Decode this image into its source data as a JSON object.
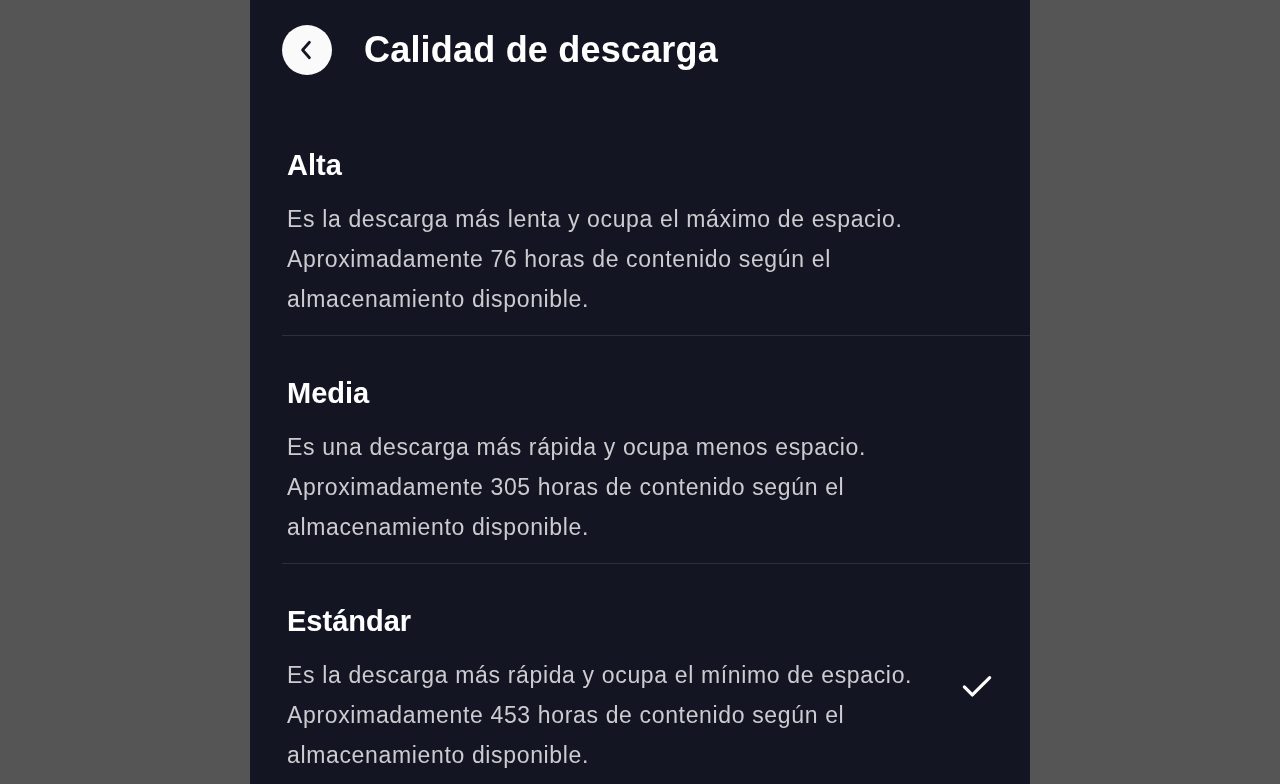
{
  "header": {
    "title": "Calidad de descarga"
  },
  "options": [
    {
      "title": "Alta",
      "description": "Es la descarga más lenta y ocupa el máximo de espacio. Aproximadamente 76 horas de contenido según el almacenamiento disponible.",
      "selected": false
    },
    {
      "title": "Media",
      "description": "Es una descarga más rápida y ocupa menos espacio. Aproximadamente 305 horas de contenido según el almacenamiento disponible.",
      "selected": false
    },
    {
      "title": "Estándar",
      "description": "Es la descarga más rápida y ocupa el mínimo de espacio. Aproximadamente 453 horas de contenido según el almacenamiento disponible.",
      "selected": true
    }
  ]
}
